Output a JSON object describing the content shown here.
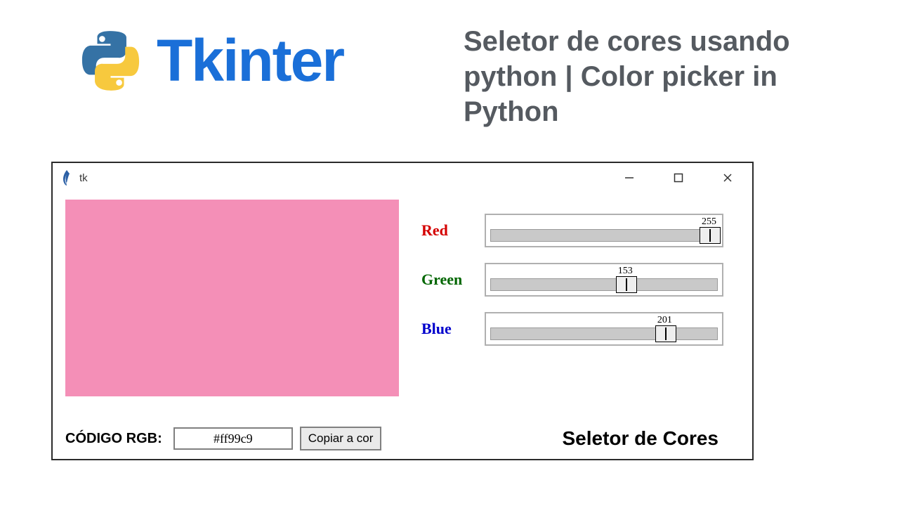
{
  "header": {
    "tkinter_word": "Tkinter",
    "page_title": "Seletor de cores usando python | Color picker in Python"
  },
  "window": {
    "title": "tk",
    "preview_color": "#f48fb7",
    "sliders": {
      "max": 255,
      "red": {
        "label": "Red",
        "value": 255
      },
      "green": {
        "label": "Green",
        "value": 153
      },
      "blue": {
        "label": "Blue",
        "value": 201
      }
    },
    "rgb_label": "CÓDIGO RGB:",
    "rgb_value": "#ff99c9",
    "copy_button": "Copiar a cor",
    "app_title": "Seletor de Cores"
  }
}
